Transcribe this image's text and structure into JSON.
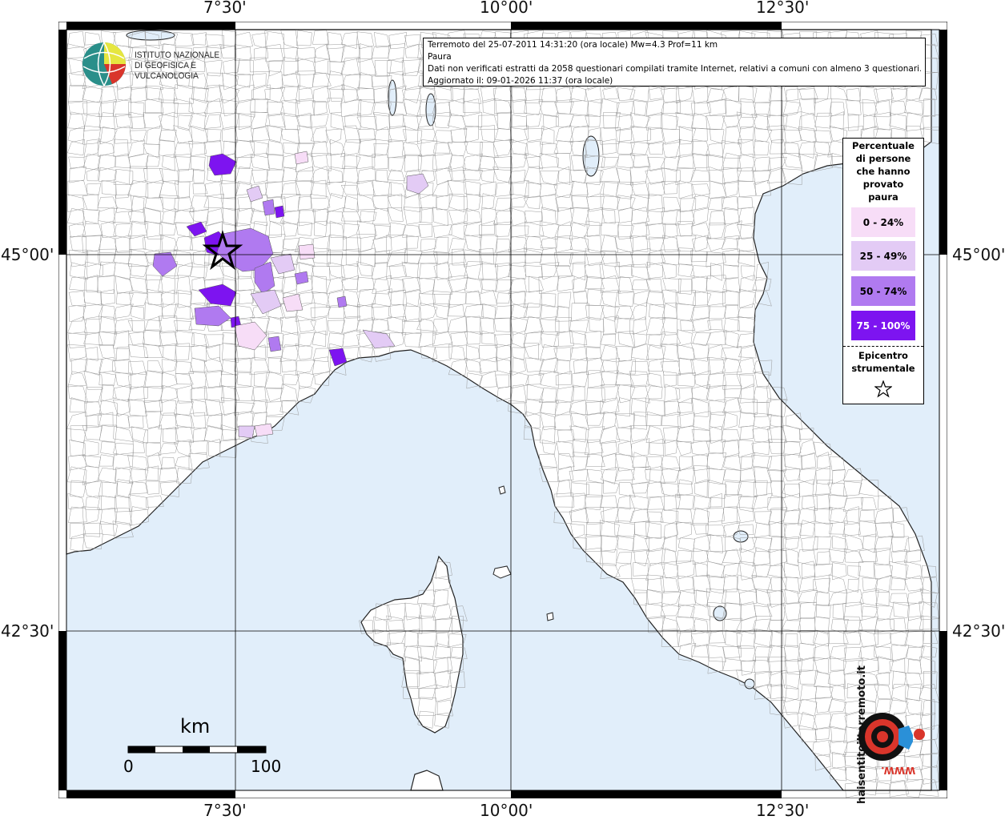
{
  "map": {
    "graticule_labels": {
      "top": [
        "7°30'",
        "10°00'",
        "12°30'"
      ],
      "bottom": [
        "7°30'",
        "10°00'",
        "12°30'"
      ],
      "left": [
        "45°00'",
        "42°30'"
      ],
      "right": [
        "45°00'",
        "42°30'"
      ]
    },
    "colors": {
      "sea": "#e1eefa",
      "land": "#ffffff",
      "borders": "#8a8a8a",
      "class_0_24": "#f7ddf7",
      "class_25_49": "#e3cbf5",
      "class_50_74": "#b07af0",
      "class_75_100": "#7d14f0"
    }
  },
  "info": {
    "line1": "Terremoto del 25-07-2011 14:31:20 (ora locale) Mw=4.3 Prof=11 km",
    "line2": "Paura",
    "line3": "Dati non verificati estratti da 2058 questionari compilati tramite Internet, relativi a comuni con almeno 3 questionari.",
    "line4": "Aggiornato il: 09-01-2026 11:37 (ora locale)"
  },
  "legend": {
    "title_lines": [
      "Percentuale",
      "di persone",
      "che hanno",
      "provato",
      "paura"
    ],
    "classes": [
      {
        "label": "0 - 24%",
        "color": "#f7ddf7"
      },
      {
        "label": "25 - 49%",
        "color": "#e3cbf5"
      },
      {
        "label": "50 - 74%",
        "color": "#b07af0"
      },
      {
        "label": "75 - 100%",
        "color": "#7d14f0"
      }
    ],
    "epicenter_lines": [
      "Epicentro",
      "strumentale"
    ],
    "epicenter_icon": "star-icon"
  },
  "logo": {
    "line1": "ISTITUTO NAZIONALE",
    "line2": "DI GEOFISICA E VULCANOLOGIA"
  },
  "scale_bar": {
    "unit": "km",
    "start": "0",
    "end": "100"
  },
  "footer_logo": {
    "text_outer": "haisentitoilterremoto.it",
    "text_inner": "WWW."
  }
}
